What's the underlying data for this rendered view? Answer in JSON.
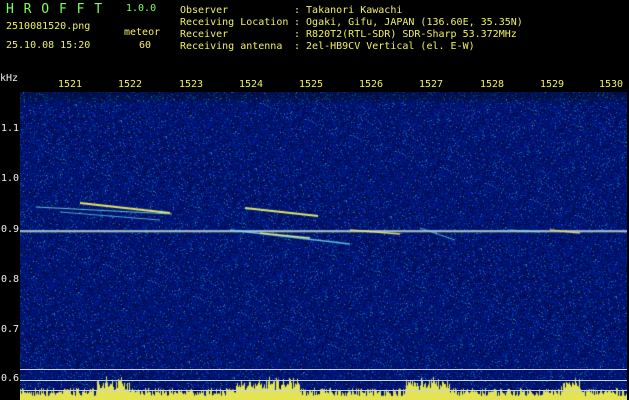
{
  "header": {
    "app_name": "H R O F F T",
    "version": "1.0.0",
    "filename": "2510081520.png",
    "datetime": "25.10.08 15:20",
    "meteor_label": "meteor",
    "meteor_count": "60"
  },
  "info": {
    "labels": [
      "Observer",
      "Receiving Location",
      "Receiver",
      "Receiving antenna"
    ],
    "values": [
      ": Takanori Kawachi",
      ": Ogaki, Gifu, JAPAN (136.60E, 35.35N)",
      ": R820T2(RTL-SDR) SDR-Sharp 53.372MHz",
      ": 2el-HB9CV Vertical (el. E-W)"
    ]
  },
  "axes": {
    "y_unit": "kHz",
    "x_ticks": [
      "1521",
      "1522",
      "1523",
      "1524",
      "1525",
      "1526",
      "1527",
      "1528",
      "1529",
      "1530"
    ],
    "y_ticks": [
      "1.1",
      "1.0",
      "0.9",
      "0.8",
      "0.7",
      "0.6"
    ]
  },
  "colors": {
    "background": "#000000",
    "header_green": "#7CFF5A",
    "header_yellow": "#F0F060",
    "spectrogram_blue": "#0A1A7A",
    "signal_yellow": "#F0F060",
    "signal_cyan": "#60F0F0"
  }
}
